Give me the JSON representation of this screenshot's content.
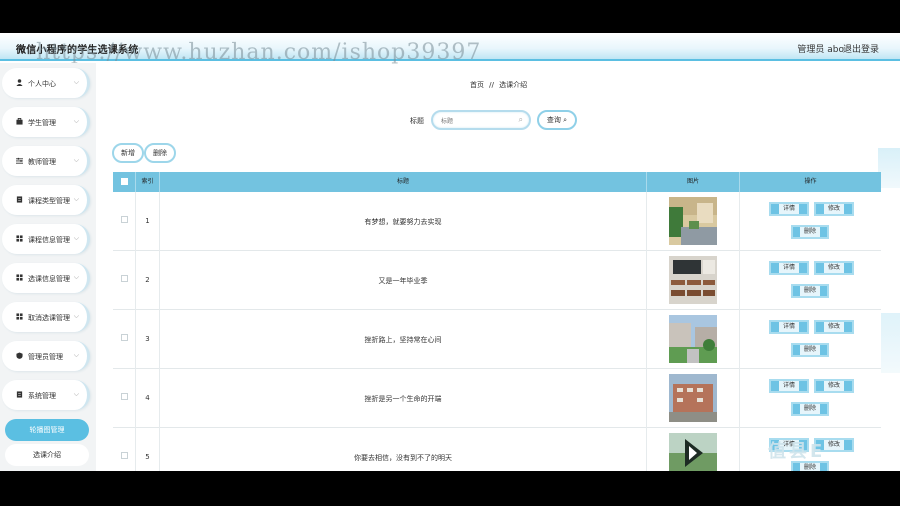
{
  "header": {
    "app_title": "微信小程序的学生选课系统",
    "user": "管理员 abo",
    "logout": "退出登录",
    "watermark": "https://www.huzhan.com/ishop39397"
  },
  "sidebar": {
    "items": [
      {
        "label": "个人中心",
        "icon": "user-icon"
      },
      {
        "label": "学生管理",
        "icon": "briefcase-icon"
      },
      {
        "label": "教师管理",
        "icon": "sliders-icon"
      },
      {
        "label": "课程类型管理",
        "icon": "document-icon"
      },
      {
        "label": "课程信息管理",
        "icon": "grid-icon"
      },
      {
        "label": "选课信息管理",
        "icon": "grid-icon"
      },
      {
        "label": "取消选课管理",
        "icon": "grid-icon"
      },
      {
        "label": "管理员管理",
        "icon": "shield-icon"
      },
      {
        "label": "系统管理",
        "icon": "document-icon"
      }
    ],
    "sub_items": [
      {
        "label": "轮播图管理",
        "active": true
      },
      {
        "label": "选课介绍",
        "active": false
      }
    ]
  },
  "breadcrumb": {
    "home": "首页",
    "separator": "//",
    "current": "选课介绍"
  },
  "search": {
    "label": "标题",
    "placeholder": "标题",
    "button": "查询"
  },
  "actions": {
    "add": "新增",
    "delete": "删除"
  },
  "table": {
    "columns": [
      "索引",
      "标题",
      "图片",
      "操作"
    ],
    "row_buttons": {
      "detail": "详情",
      "edit": "修改",
      "delete": "删除"
    },
    "rows": [
      {
        "index": "1",
        "title": "有梦想，就要努力去实现",
        "image": "campus-building-photo"
      },
      {
        "index": "2",
        "title": "又是一年毕业季",
        "image": "classroom-photo"
      },
      {
        "index": "3",
        "title": "挫折路上，坚持常在心间",
        "image": "campus-courtyard-photo"
      },
      {
        "index": "4",
        "title": "挫折是另一个生命的开端",
        "image": "school-building-photo"
      },
      {
        "index": "5",
        "title": "你要去相信，没有到不了的明天",
        "image": "video-thumbnail"
      }
    ]
  },
  "overlay_text": "值县E",
  "colors": {
    "accent": "#5bbfe2",
    "table_header": "#73c3e0",
    "button": "#6ec3e4"
  }
}
